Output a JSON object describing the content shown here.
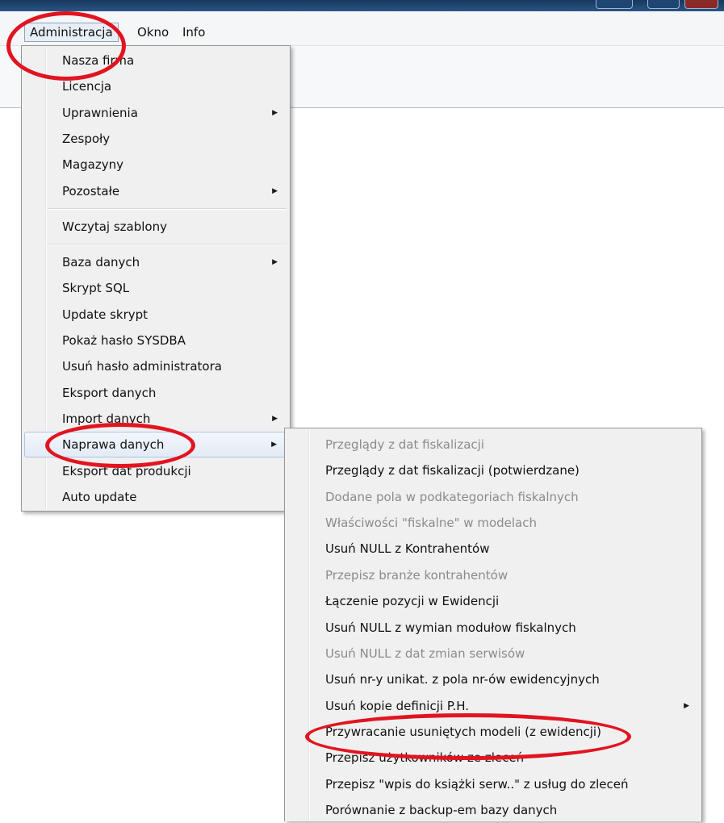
{
  "menubar": {
    "items": [
      {
        "label": "Administracja"
      },
      {
        "label": "Okno"
      },
      {
        "label": "Info"
      }
    ]
  },
  "admin_menu": {
    "items": [
      {
        "label": "Nasza firma"
      },
      {
        "label": "Licencja"
      },
      {
        "label": "Uprawnienia"
      },
      {
        "label": "Zespoły"
      },
      {
        "label": "Magazyny"
      },
      {
        "label": "Pozostałe"
      },
      {
        "label": "Wczytaj szablony"
      },
      {
        "label": "Baza danych"
      },
      {
        "label": "Skrypt SQL"
      },
      {
        "label": "Update skrypt"
      },
      {
        "label": "Pokaż hasło SYSDBA"
      },
      {
        "label": "Usuń hasło administratora"
      },
      {
        "label": "Eksport danych"
      },
      {
        "label": "Import danych"
      },
      {
        "label": "Naprawa danych"
      },
      {
        "label": "Eksport dat produkcji"
      },
      {
        "label": "Auto update"
      }
    ]
  },
  "repair_menu": {
    "items": [
      {
        "label": "Przeglądy z dat fiskalizacji"
      },
      {
        "label": "Przeglądy z dat fiskalizacji (potwierdzane)"
      },
      {
        "label": "Dodane pola w podkategoriach fiskalnych"
      },
      {
        "label": "Właściwości \"fiskalne\" w modelach"
      },
      {
        "label": "Usuń NULL z Kontrahentów"
      },
      {
        "label": "Przepisz branże kontrahentów"
      },
      {
        "label": "Łączenie pozycji w Ewidencji"
      },
      {
        "label": "Usuń NULL z wymian  modułow fiskalnych"
      },
      {
        "label": "Usuń NULL z dat zmian serwisów"
      },
      {
        "label": "Usuń nr-y unikat. z pola nr-ów ewidencyjnych"
      },
      {
        "label": "Usuń kopie definicji P.H."
      },
      {
        "label": "Przywracanie usuniętych modeli (z ewidencji)"
      },
      {
        "label": "Przepisz użytkowników ze zleceń"
      },
      {
        "label": "Przepisz \"wpis do książki serw..\" z usług do zleceń"
      },
      {
        "label": "Porównanie z backup-em bazy danych"
      }
    ]
  },
  "icons": {
    "submenu_arrow": "submenu-arrow-icon"
  },
  "colors": {
    "highlight_circle": "#e2141f"
  }
}
